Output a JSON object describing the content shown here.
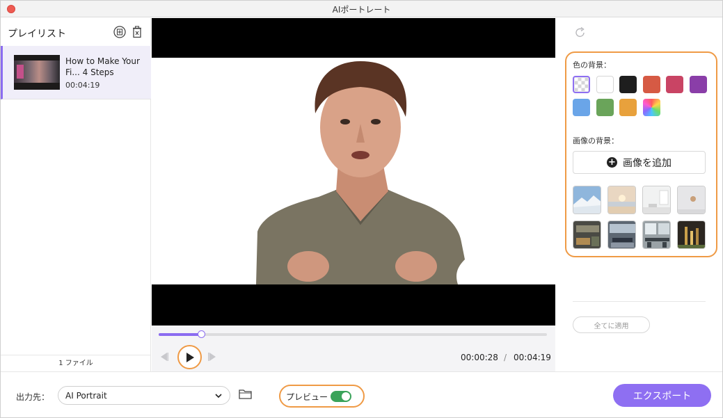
{
  "window": {
    "title": "AIポートレート"
  },
  "sidebar": {
    "title": "プレイリスト",
    "items": [
      {
        "title": "How to Make Your Fi... 4 Steps",
        "duration": "00:04:19"
      }
    ],
    "file_count": "1 ファイル"
  },
  "player": {
    "current_time": "00:00:28",
    "separator": "/",
    "total_time": "00:04:19",
    "progress_fraction": 0.11
  },
  "background_panel": {
    "color_label": "色の背景：",
    "colors": [
      "transparent",
      "#ffffff",
      "#1e1e1e",
      "#d65a44",
      "#c94464",
      "#8a3ea8",
      "#6aa5e8",
      "#6aa45a",
      "#e8a13c",
      "rainbow"
    ],
    "image_label": "画像の背景：",
    "add_image_label": "画像を追加",
    "image_thumbnails": [
      "snow-mountain",
      "beach-sunset",
      "white-room",
      "white-wall",
      "office-lounge",
      "meeting-room",
      "open-office",
      "night-city"
    ],
    "apply_all_label": "全てに適用"
  },
  "bottom_bar": {
    "output_label": "出力先：",
    "output_value": "AI Portrait",
    "preview_label": "プレビュー",
    "preview_on": true,
    "export_label": "エクスポート"
  },
  "colors": {
    "accent": "#8e6ff2",
    "highlight": "#ef9a45",
    "toggle_on": "#3aa35a"
  }
}
